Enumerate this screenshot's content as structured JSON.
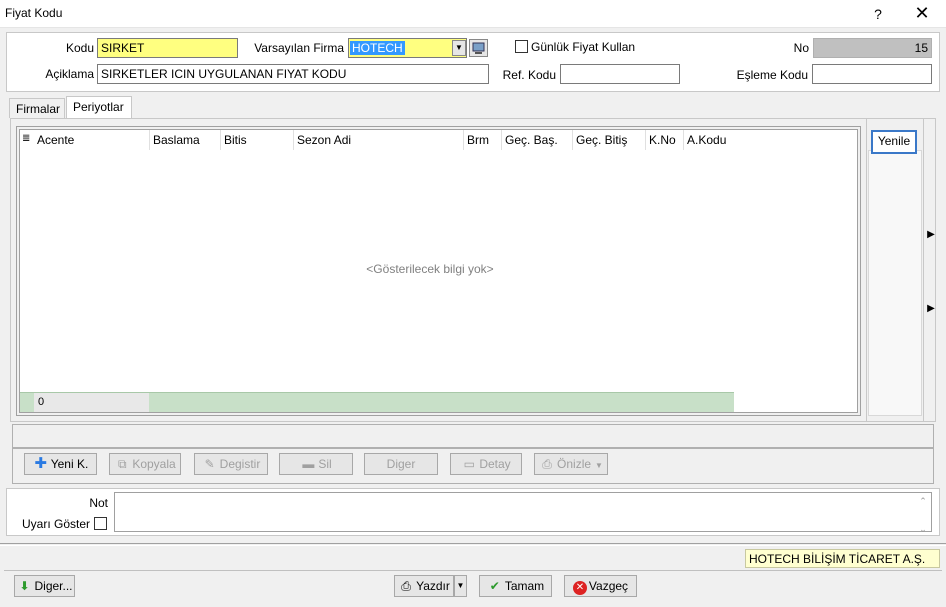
{
  "window": {
    "title": "Fiyat Kodu",
    "help": "?",
    "close": "✕"
  },
  "form": {
    "kodu_label": "Kodu",
    "kodu_value": "SIRKET",
    "varsayilan_firma_label": "Varsayılan Firma",
    "varsayilan_firma_value": "HOTECH",
    "gunluk_fiyat_label": "Günlük Fiyat Kullan",
    "gunluk_fiyat_checked": false,
    "no_label": "No",
    "no_value": "15",
    "aciklama_label": "Açiklama",
    "aciklama_value": "SIRKETLER ICIN UYGULANAN FIYAT KODU",
    "ref_kodu_label": "Ref. Kodu",
    "ref_kodu_value": "",
    "esleme_kodu_label": "Eşleme Kodu",
    "esleme_kodu_value": ""
  },
  "tabs": [
    {
      "label": "Firmalar",
      "active": false
    },
    {
      "label": "Periyotlar",
      "active": true
    }
  ],
  "grid": {
    "columns": [
      "Acente",
      "Baslama",
      "Bitis",
      "Sezon Adi",
      "Brm",
      "Geç. Baş.",
      "Geç. Bitiş",
      "K.No",
      "A.Kodu"
    ],
    "empty_message": "<Gösterilecek bilgi yok>",
    "footer_count": "0"
  },
  "side": {
    "refresh_label": "Yenile"
  },
  "actions": {
    "yeni": "Yeni K.",
    "kopyala": "Kopyala",
    "degistir": "Degistir",
    "sil": "Sil",
    "diger": "Diger",
    "detay": "Detay",
    "onizle": "Önizle"
  },
  "note": {
    "not_label": "Not",
    "uyari_label": "Uyarı Göster",
    "uyari_checked": false
  },
  "status": {
    "company": "HOTECH BİLİŞİM TİCARET A.Ş."
  },
  "bottom": {
    "diger": "Diger...",
    "yazdir": "Yazdır",
    "tamam": "Tamam",
    "vazgec": "Vazgeç"
  },
  "colors": {
    "accent": "#3a78c8",
    "yellow_field": "#ffff80",
    "selection": "#3399ff",
    "grid_footer": "#c8e0c8"
  }
}
